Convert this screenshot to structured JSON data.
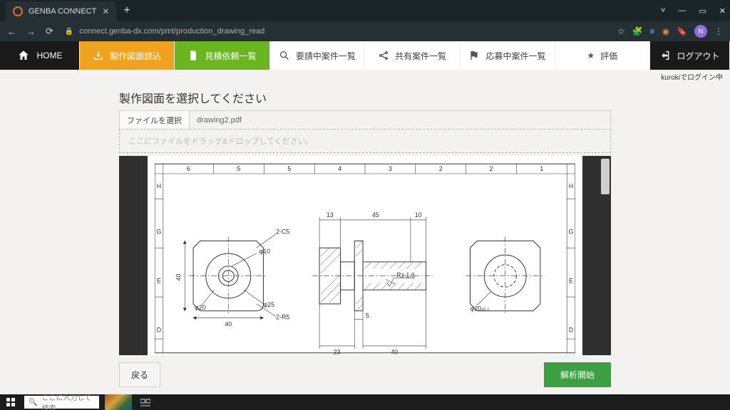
{
  "browser": {
    "tab_title": "GENBA CONNECT",
    "url": "connect.genba-dx.com/pmt/production_drawing_read",
    "avatar_letter": "N"
  },
  "nav": {
    "home": "HOME",
    "read": "製作図面読込",
    "quote": "見積依頼一覧",
    "request": "要請中案件一覧",
    "share": "共有案件一覧",
    "apply": "応募中案件一覧",
    "rating": "評価",
    "logout": "ログアウト"
  },
  "login_status": "kurokiでログイン中",
  "page": {
    "title": "製作図面を選択してください",
    "file_button": "ファイルを選択",
    "file_name": "drawing2.pdf",
    "drop_hint": "ここにファイルをドラッグ&ドロップしてください。"
  },
  "drawing": {
    "cols": [
      "6",
      "5",
      "5",
      "4",
      "3",
      "2",
      "2",
      "1"
    ],
    "rows": [
      "H",
      "G",
      "E",
      "D"
    ],
    "dims": {
      "left_width": "40",
      "left_height": "40",
      "phi10": "φ10",
      "phi20": "φ20",
      "phi25": "φ25",
      "chamfer": "2-C5",
      "radius": "2-R5",
      "mid_13": "13",
      "mid_45": "45",
      "mid_10": "10",
      "mid_23": "23",
      "mid_40": "40",
      "mid_5": "5",
      "rz": "Rz 1.6",
      "right_phi20": "φ20",
      "right_tol": "±0.1"
    }
  },
  "buttons": {
    "back": "戻る",
    "start": "解析開始"
  },
  "taskbar": {
    "search_placeholder": "ここに入力して検索"
  }
}
